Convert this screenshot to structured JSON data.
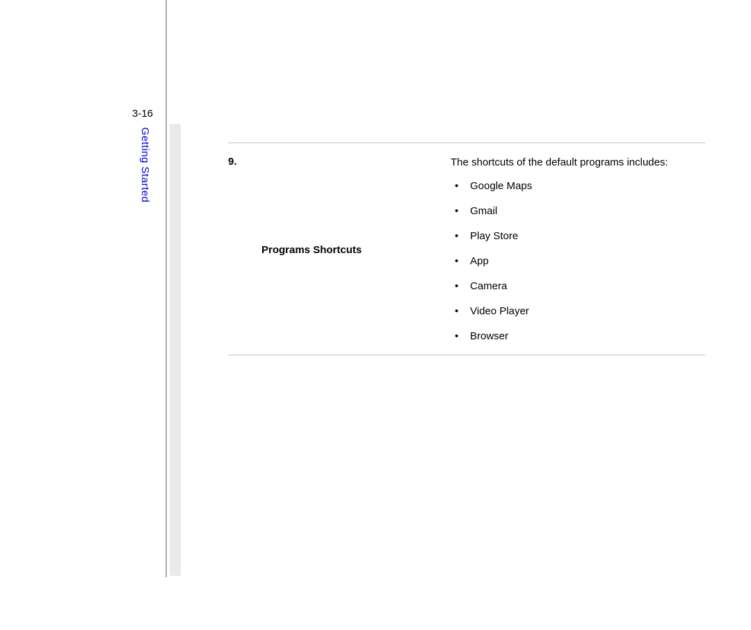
{
  "page_number": "3-16",
  "section_title": "Getting Started",
  "row": {
    "number": "9.",
    "label": "Programs Shortcuts",
    "intro": "The shortcuts of the default programs includes:",
    "items": [
      "Google Maps",
      "Gmail",
      "Play Store",
      "App",
      "Camera",
      "Video Player",
      "Browser"
    ]
  }
}
